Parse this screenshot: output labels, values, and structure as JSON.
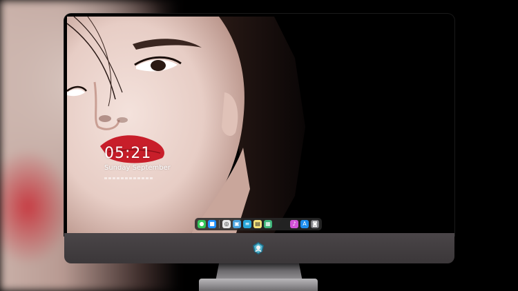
{
  "lock_screen": {
    "time": "05:21",
    "date": "Sunday September"
  },
  "dock": {
    "icons": [
      {
        "name": "messages-icon",
        "glyph": "●",
        "color": "#34c759"
      },
      {
        "name": "finder-icon",
        "glyph": "■",
        "color": "#1e90ff"
      },
      {
        "name": "safari-icon",
        "glyph": "◎",
        "color": "#e8e8e8"
      },
      {
        "name": "preview-icon",
        "glyph": "▣",
        "color": "#4aa3df"
      },
      {
        "name": "clapper-icon",
        "glyph": "≡",
        "color": "#28a7d9"
      },
      {
        "name": "notes-icon",
        "glyph": "▤",
        "color": "#f5e27a"
      },
      {
        "name": "photos-app-icon",
        "glyph": "▦",
        "color": "#3fb57a"
      },
      {
        "name": "itunes-icon",
        "glyph": "♪",
        "color": "#d252d8"
      },
      {
        "name": "app-store-icon",
        "glyph": "A",
        "color": "#1c8cf0"
      },
      {
        "name": "camera-icon",
        "glyph": "◙",
        "color": "#7b7b80"
      }
    ]
  },
  "colors": {
    "chin": "#3b3739",
    "stand": "#9a989b",
    "lips": "#c81e2a"
  }
}
